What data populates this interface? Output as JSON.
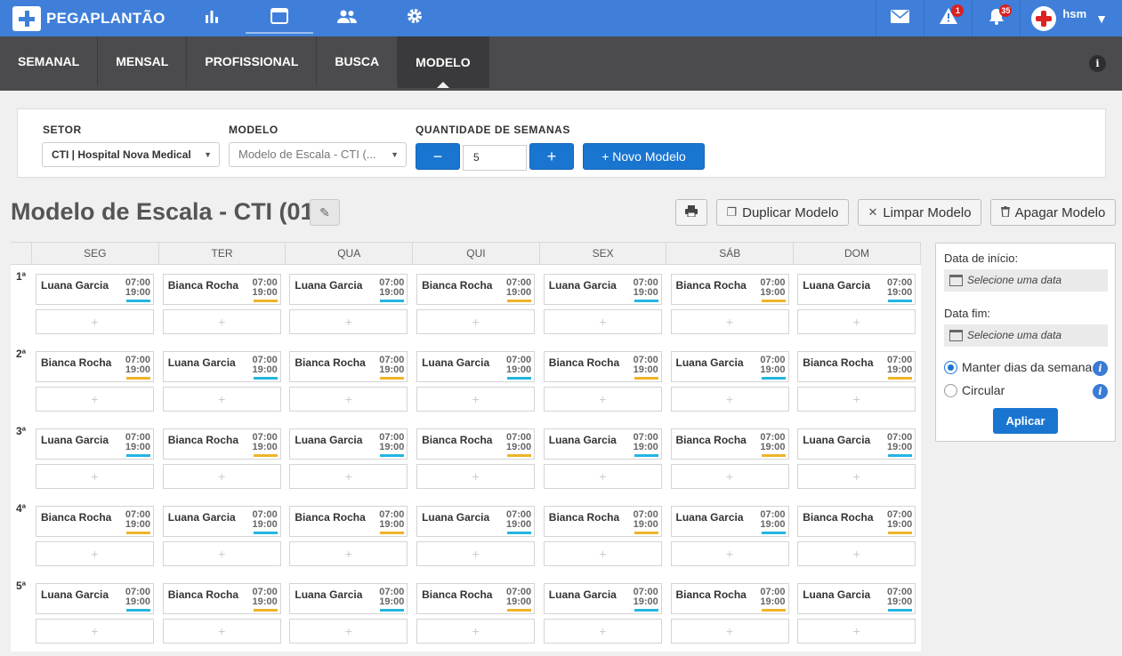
{
  "app": {
    "brand": "PEGAPLANTÃO"
  },
  "topbar": {
    "nav": [
      {
        "icon": "chart-icon",
        "glyph": "▮▮▮"
      },
      {
        "icon": "calendar-window-icon",
        "glyph": "▭"
      },
      {
        "icon": "people-icon",
        "glyph": "👥"
      },
      {
        "icon": "gear-icon",
        "glyph": "⚙"
      }
    ],
    "mail_glyph": "✉",
    "alert_glyph": "⚠",
    "alert_count": "1",
    "bell_glyph": "🔔",
    "bell_count": "35",
    "user": "hsm",
    "caret": "▼"
  },
  "subnav": {
    "items": [
      "SEMANAL",
      "MENSAL",
      "PROFISSIONAL",
      "BUSCA",
      "MODELO"
    ],
    "info": "i"
  },
  "filter": {
    "setor_label": "SETOR",
    "setor_value": "CTI | Hospital Nova Medical",
    "modelo_label": "MODELO",
    "modelo_value": "Modelo de Escala - CTI (...",
    "qtd_label": "QUANTIDADE DE SEMANAS",
    "minus": "−",
    "qtd_value": "5",
    "plus": "+",
    "novo_modelo": "+ Novo Modelo"
  },
  "title": "Modelo de Escala - CTI (01)",
  "edit_glyph": "✎",
  "actions": {
    "print_glyph": "🖶",
    "duplicate": "Duplicar Modelo",
    "duplicate_glyph": "❐",
    "clear": "Limpar Modelo",
    "clear_glyph": "✕",
    "delete": "Apagar Modelo",
    "delete_glyph": "🗑"
  },
  "grid": {
    "days": [
      "SEG",
      "TER",
      "QUA",
      "QUI",
      "SEX",
      "SÁB",
      "DOM"
    ],
    "start_time": "07:00",
    "end_time": "19:00",
    "add_glyph": "+",
    "colors": {
      "cyan": "#25b5e0",
      "gold": "#f0b429"
    },
    "weeks": [
      {
        "label": "1ª",
        "shifts": [
          {
            "name": "Luana Garcia",
            "color": "#25b5e0"
          },
          {
            "name": "Bianca Rocha",
            "color": "#f0b429"
          },
          {
            "name": "Luana Garcia",
            "color": "#25b5e0"
          },
          {
            "name": "Bianca Rocha",
            "color": "#f0b429"
          },
          {
            "name": "Luana Garcia",
            "color": "#25b5e0"
          },
          {
            "name": "Bianca Rocha",
            "color": "#f0b429"
          },
          {
            "name": "Luana Garcia",
            "color": "#25b5e0"
          }
        ]
      },
      {
        "label": "2ª",
        "shifts": [
          {
            "name": "Bianca Rocha",
            "color": "#f0b429"
          },
          {
            "name": "Luana Garcia",
            "color": "#25b5e0"
          },
          {
            "name": "Bianca Rocha",
            "color": "#f0b429"
          },
          {
            "name": "Luana Garcia",
            "color": "#25b5e0"
          },
          {
            "name": "Bianca Rocha",
            "color": "#f0b429"
          },
          {
            "name": "Luana Garcia",
            "color": "#25b5e0"
          },
          {
            "name": "Bianca Rocha",
            "color": "#f0b429"
          }
        ]
      },
      {
        "label": "3ª",
        "shifts": [
          {
            "name": "Luana Garcia",
            "color": "#25b5e0"
          },
          {
            "name": "Bianca Rocha",
            "color": "#f0b429"
          },
          {
            "name": "Luana Garcia",
            "color": "#25b5e0"
          },
          {
            "name": "Bianca Rocha",
            "color": "#f0b429"
          },
          {
            "name": "Luana Garcia",
            "color": "#25b5e0"
          },
          {
            "name": "Bianca Rocha",
            "color": "#f0b429"
          },
          {
            "name": "Luana Garcia",
            "color": "#25b5e0"
          }
        ]
      },
      {
        "label": "4ª",
        "shifts": [
          {
            "name": "Bianca Rocha",
            "color": "#f0b429"
          },
          {
            "name": "Luana Garcia",
            "color": "#25b5e0"
          },
          {
            "name": "Bianca Rocha",
            "color": "#f0b429"
          },
          {
            "name": "Luana Garcia",
            "color": "#25b5e0"
          },
          {
            "name": "Bianca Rocha",
            "color": "#f0b429"
          },
          {
            "name": "Luana Garcia",
            "color": "#25b5e0"
          },
          {
            "name": "Bianca Rocha",
            "color": "#f0b429"
          }
        ]
      },
      {
        "label": "5ª",
        "shifts": [
          {
            "name": "Luana Garcia",
            "color": "#25b5e0"
          },
          {
            "name": "Bianca Rocha",
            "color": "#f0b429"
          },
          {
            "name": "Luana Garcia",
            "color": "#25b5e0"
          },
          {
            "name": "Bianca Rocha",
            "color": "#f0b429"
          },
          {
            "name": "Luana Garcia",
            "color": "#25b5e0"
          },
          {
            "name": "Bianca Rocha",
            "color": "#f0b429"
          },
          {
            "name": "Luana Garcia",
            "color": "#25b5e0"
          }
        ]
      }
    ]
  },
  "side": {
    "start_label": "Data de início:",
    "start_placeholder": "Selecione uma data",
    "end_label": "Data fim:",
    "end_placeholder": "Selecione uma data",
    "option_keep": "Manter dias da semana",
    "option_circular": "Circular",
    "info": "i",
    "apply": "Aplicar"
  }
}
